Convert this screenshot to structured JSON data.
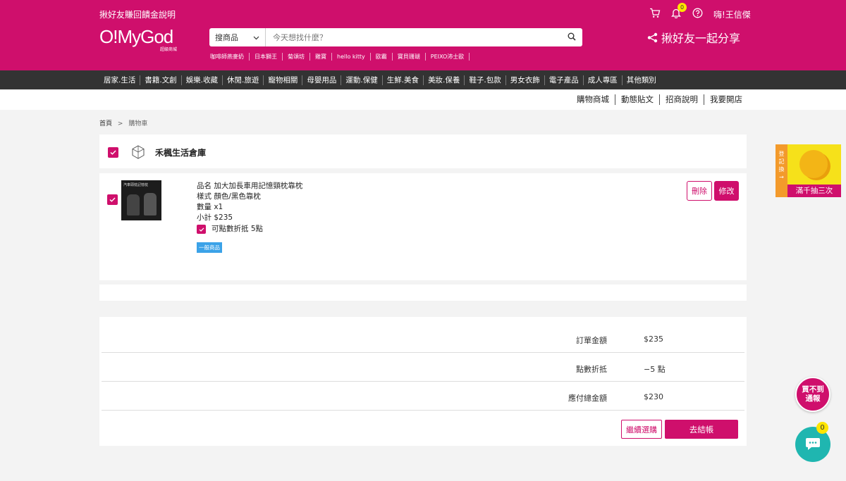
{
  "header": {
    "promo_link": "揪好友賺回饋金說明",
    "logo_main": "O!MyGod",
    "logo_sub": "超級商城",
    "search": {
      "select": "搜商品",
      "placeholder": "今天想找什麼？"
    },
    "hot_keys": [
      "咖啡師燕麥奶",
      "日本獅王",
      "菊頌坊",
      "雞寶",
      "hello kitty",
      "歐霸",
      "寶貝珊瑚",
      "PEIXO沛士歐"
    ],
    "cart_badge": "0",
    "user": "嗨!王信傑",
    "share": "揪好友一起分享"
  },
  "catnav": [
    "居家.生活",
    "書籍.文創",
    "娛樂.收藏",
    "休閒.旅遊",
    "寵物相關",
    "母嬰用品",
    "運動.保健",
    "生鮮.美食",
    "美妝.保養",
    "鞋子.包款",
    "男女衣飾",
    "電子產品",
    "成人專區",
    "其他類別"
  ],
  "subnav": [
    "購物商城",
    "動態貼文",
    "招商說明",
    "我要開店"
  ],
  "breadcrumb": {
    "home": "首頁",
    "sep": ">",
    "current": "購物車"
  },
  "store": {
    "name": "禾楓生活倉庫"
  },
  "item": {
    "image_text": "汽車頭枕記憶枕",
    "name": "品名 加大加長車用記憶頸枕靠枕",
    "style": "樣式 顏色/黑色靠枕",
    "qty": "數量 x1",
    "subtotal": "小計  $235",
    "points": "可點數折抵 5點",
    "tag": "一般商品",
    "delete_label": "刪除",
    "edit_label": "修改"
  },
  "summary": {
    "rows": [
      {
        "label": "訂單金額",
        "value": "$235"
      },
      {
        "label": "點數折抵",
        "value": "−5 點"
      },
      {
        "label": "應付總金額",
        "value": "$230"
      }
    ],
    "continue_label": "繼續選購",
    "checkout_label": "去結帳"
  },
  "floats": {
    "lottery_side": [
      "登",
      "記",
      "換",
      "→"
    ],
    "lottery_text": "滿千抽三次",
    "notify": [
      "買不到",
      "通報"
    ],
    "chat_badge": "0"
  },
  "colors": {
    "brand": "#cf0f6c",
    "nav": "#333333",
    "tag": "#3ba2e8",
    "chat": "#1fb6b0"
  }
}
